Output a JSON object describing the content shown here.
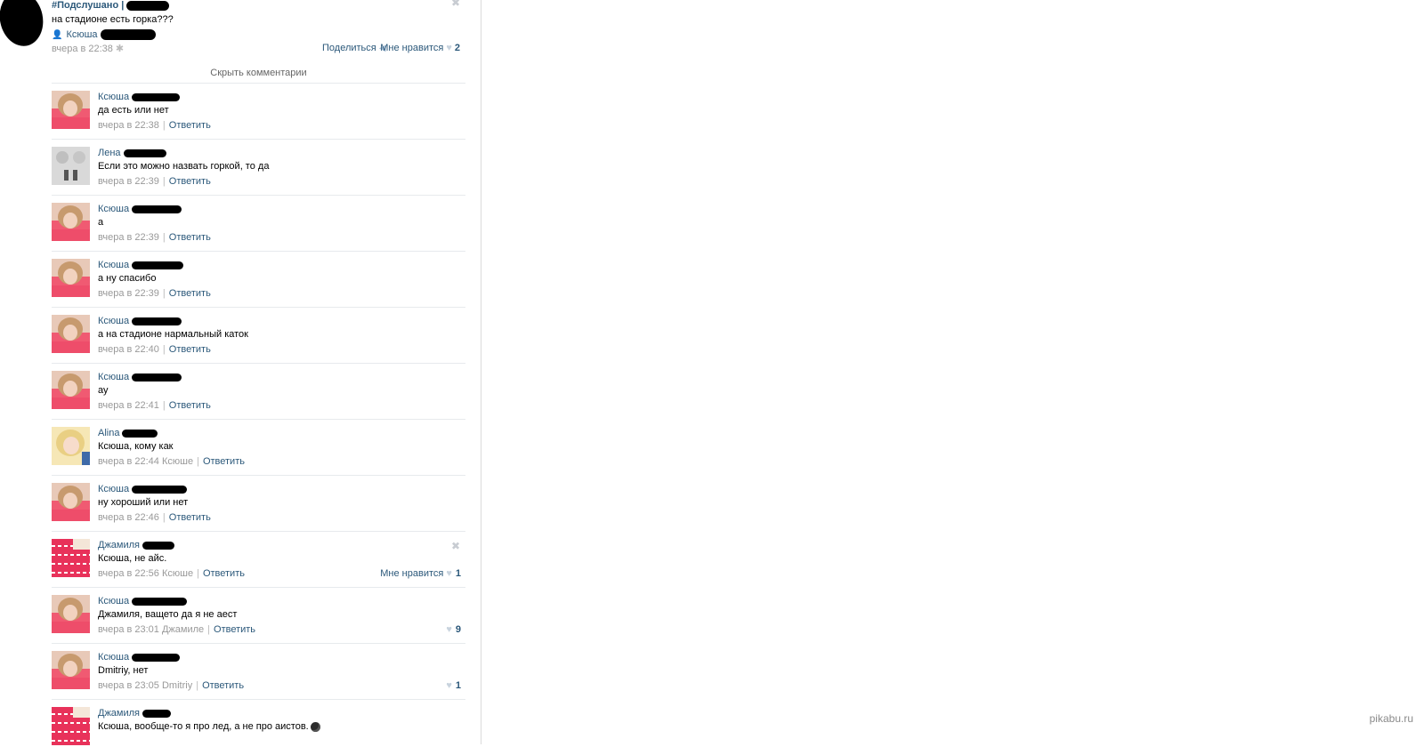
{
  "post": {
    "author": "#Подслушано |",
    "text": "на стадионе есть горка???",
    "signer": "Ксюша",
    "time": "вчера в 22:38",
    "share": "Поделиться",
    "like_label": "Мне нравится",
    "like_count": "2"
  },
  "hide_comments": "Скрыть комментарии",
  "reply_label": "Ответить",
  "comments": [
    {
      "name": "Ксюша",
      "text": "да есть или нет",
      "time": "вчера в 22:38",
      "to": "",
      "like_label": "",
      "likes": "",
      "avatar": "pink"
    },
    {
      "name": "Лена",
      "text": "Если это можно назвать горкой, то да",
      "time": "вчера в 22:39",
      "to": "",
      "like_label": "",
      "likes": "",
      "avatar": "gray"
    },
    {
      "name": "Ксюша",
      "text": "а",
      "time": "вчера в 22:39",
      "to": "",
      "like_label": "",
      "likes": "",
      "avatar": "pink"
    },
    {
      "name": "Ксюша",
      "text": "а ну спасибо",
      "time": "вчера в 22:39",
      "to": "",
      "like_label": "",
      "likes": "",
      "avatar": "pink"
    },
    {
      "name": "Ксюша",
      "text": "а на стадионе нармальный каток",
      "time": "вчера в 22:40",
      "to": "",
      "like_label": "",
      "likes": "",
      "avatar": "pink"
    },
    {
      "name": "Ксюша",
      "text": "ау",
      "time": "вчера в 22:41",
      "to": "",
      "like_label": "",
      "likes": "",
      "avatar": "pink"
    },
    {
      "name": "Alina",
      "text": "Ксюша, кому как",
      "time": "вчера в 22:44",
      "to": "Ксюше",
      "like_label": "",
      "likes": "",
      "avatar": "blonde"
    },
    {
      "name": "Ксюша",
      "text": "ну хороший или нет",
      "time": "вчера в 22:46",
      "to": "",
      "like_label": "",
      "likes": "",
      "avatar": "pink"
    },
    {
      "name": "Джамиля",
      "text": "Ксюша, не айс.",
      "time": "вчера в 22:56",
      "to": "Ксюше",
      "like_label": "Мне нравится",
      "likes": "1",
      "avatar": "pattern"
    },
    {
      "name": "Ксюша",
      "text": "Джамиля, ващето да я не аест",
      "time": "вчера в 23:01",
      "to": "Джамиле",
      "like_label": "",
      "likes": "9",
      "avatar": "pink"
    },
    {
      "name": "Ксюша",
      "text": "Dmitriy, нет",
      "time": "вчера в 23:05",
      "to": "Dmitriy",
      "like_label": "",
      "likes": "1",
      "avatar": "pink"
    },
    {
      "name": "Джамиля",
      "text": "Ксюша, вообще-то я про лед, а не про аистов.",
      "time": "",
      "to": "",
      "like_label": "",
      "likes": "",
      "avatar": "pattern"
    }
  ],
  "watermark": "pikabu.ru"
}
